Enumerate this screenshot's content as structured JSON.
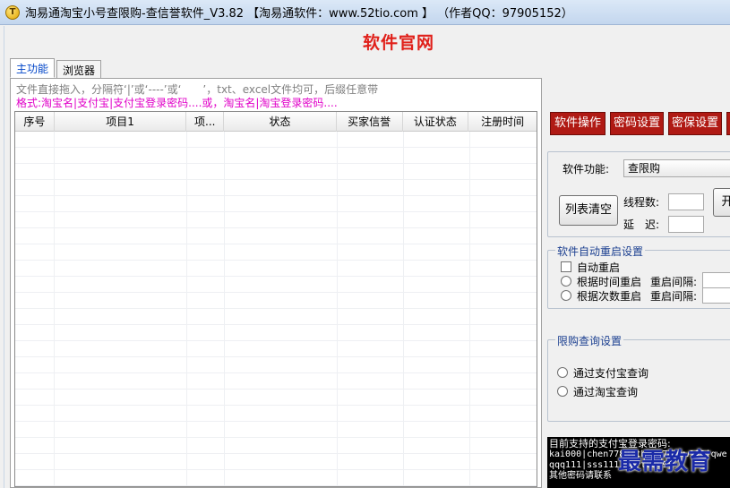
{
  "window": {
    "title": "淘易通淘宝小号查限购-查信誉软件_V3.82 【淘易通软件：www.52tio.com 】 （作者QQ：97905152）",
    "icon": "app-logo-icon"
  },
  "site_title": "软件官网",
  "tabs": [
    {
      "label": "主功能",
      "active": true
    },
    {
      "label": "浏览器",
      "active": false
    }
  ],
  "hints": {
    "line1": "文件直接拖入，分隔符‘|’或‘----’或‘　　’，txt、excel文件均可，后缀任意带",
    "line2": "格式:淘宝名|支付宝|支付宝登录密码....或，淘宝名|淘宝登录密码...."
  },
  "grid": {
    "columns": [
      "序号",
      "项目1",
      "项...",
      "状态",
      "买家信誉",
      "认证状态",
      "注册时间"
    ],
    "rows": []
  },
  "toolbar": {
    "software_ops": "软件操作",
    "password_settings": "密码设置",
    "security_settings": "密保设置"
  },
  "function_panel": {
    "function_label": "软件功能:",
    "function_value": "查限购",
    "clear_list": "列表清空",
    "threads_label": "线程数:",
    "threads_value": "",
    "delay_label": "延　迟:",
    "delay_value": "",
    "start_label": "开"
  },
  "restart_panel": {
    "legend": "软件自动重启设置",
    "auto_restart": "自动重启",
    "by_time": "根据时间重启",
    "by_count": "根据次数重启",
    "interval_label": "重启间隔:",
    "interval_label_2": "重启间隔:"
  },
  "limit_panel": {
    "legend": "限购查询设置",
    "via_alipay": "通过支付宝查询",
    "via_taobao": "通过淘宝查询"
  },
  "console": {
    "lines": [
      " 目前支持的支付宝登录密码:",
      "kai000|chen7788|tb-217|www111|qwe",
      "qqq111|sss111|eqrt6899",
      "其他密码请联系"
    ]
  },
  "watermark": "最需教育",
  "colors": {
    "accent_red": "#b01a14",
    "title_red": "#e0201a",
    "hint_magenta": "#e000c8",
    "legend_blue": "#1b3f90"
  }
}
